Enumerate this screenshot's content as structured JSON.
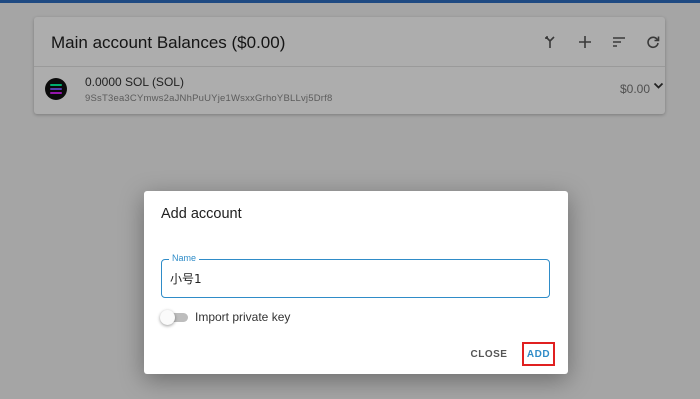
{
  "card": {
    "title": "Main account Balances ($0.00)",
    "icons": [
      "merge-icon",
      "add-icon",
      "sort-icon",
      "refresh-icon"
    ]
  },
  "token": {
    "amount": "0.0000 SOL (SOL)",
    "address": "9SsT3ea3CYmws2aJNhPuUYje1WsxxGrhoYBLLvj5Drf8",
    "value": "$0.00",
    "logo_colors": [
      "#00ffa3",
      "#7b61ff",
      "#dc1fff"
    ]
  },
  "dialog": {
    "title": "Add account",
    "name_label": "Name",
    "name_value": "小号1",
    "toggle_label": "Import private key",
    "toggle_on": false,
    "close_label": "CLOSE",
    "add_label": "ADD"
  },
  "colors": {
    "accent": "#2f8cc8",
    "highlight_border": "#e02020"
  }
}
